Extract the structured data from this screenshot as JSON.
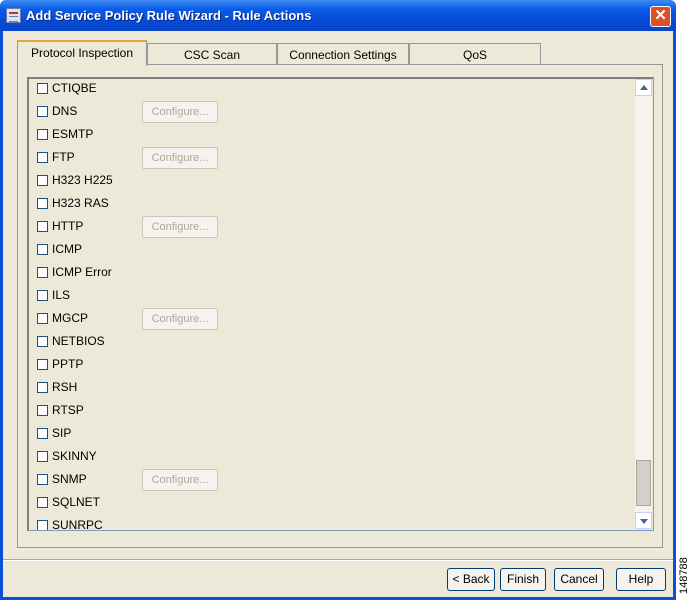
{
  "window": {
    "title": "Add Service Policy Rule Wizard - Rule Actions",
    "close_icon": "close-icon"
  },
  "tabs": [
    {
      "label": "Protocol Inspection",
      "active": true
    },
    {
      "label": "CSC Scan",
      "active": false
    },
    {
      "label": "Connection Settings",
      "active": false
    },
    {
      "label": "QoS",
      "active": false
    }
  ],
  "protocols": [
    {
      "label": "CTIQBE",
      "checked": false,
      "configure": null
    },
    {
      "label": "DNS",
      "checked": false,
      "configure": "Configure..."
    },
    {
      "label": "ESMTP",
      "checked": false,
      "configure": null
    },
    {
      "label": "FTP",
      "checked": false,
      "configure": "Configure..."
    },
    {
      "label": "H323 H225",
      "checked": false,
      "configure": null
    },
    {
      "label": "H323 RAS",
      "checked": false,
      "configure": null
    },
    {
      "label": "HTTP",
      "checked": false,
      "configure": "Configure..."
    },
    {
      "label": "ICMP",
      "checked": false,
      "configure": null
    },
    {
      "label": "ICMP Error",
      "checked": false,
      "configure": null
    },
    {
      "label": "ILS",
      "checked": false,
      "configure": null
    },
    {
      "label": "MGCP",
      "checked": false,
      "configure": "Configure..."
    },
    {
      "label": "NETBIOS",
      "checked": false,
      "configure": null
    },
    {
      "label": "PPTP",
      "checked": false,
      "configure": null
    },
    {
      "label": "RSH",
      "checked": false,
      "configure": null
    },
    {
      "label": "RTSP",
      "checked": false,
      "configure": null
    },
    {
      "label": "SIP",
      "checked": false,
      "configure": null
    },
    {
      "label": "SKINNY",
      "checked": false,
      "configure": null
    },
    {
      "label": "SNMP",
      "checked": false,
      "configure": "Configure..."
    },
    {
      "label": "SQLNET",
      "checked": false,
      "configure": null
    },
    {
      "label": "SUNRPC",
      "checked": false,
      "configure": null
    }
  ],
  "buttons": {
    "back": "< Back",
    "finish": "Finish",
    "cancel": "Cancel",
    "help": "Help"
  },
  "side_code": "148788",
  "colors": {
    "titlebar": "#0548d4",
    "dialog_bg": "#ece9d8",
    "active_tab_accent": "#e8a33c",
    "close_button": "#d9502b"
  }
}
